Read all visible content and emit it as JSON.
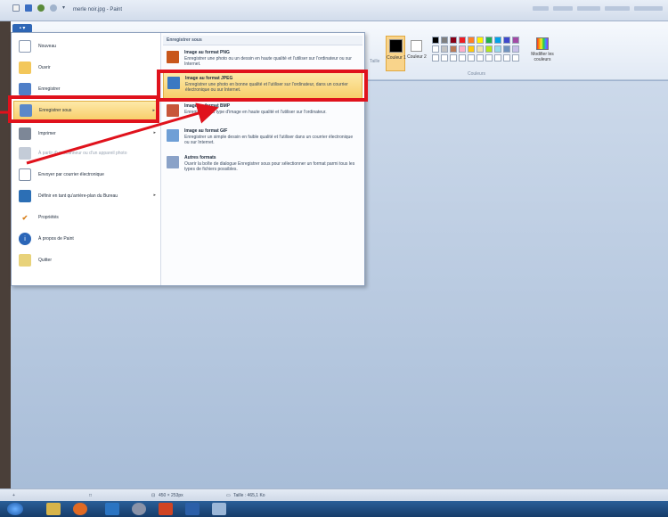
{
  "window": {
    "title": "merle noir.jpg - Paint",
    "file_tab": "▪ ▾"
  },
  "colors_panel": {
    "tail_label": "Taille",
    "color1_label": "Couleur 1",
    "color2_label": "Couleur 2",
    "edit_label": "Modifier les couleurs",
    "footer": "Couleurs",
    "swatches": [
      "#000000",
      "#7f7f7f",
      "#880015",
      "#ed1c24",
      "#ff7f27",
      "#fff200",
      "#22b14c",
      "#00a2e8",
      "#3f48cc",
      "#a349a4",
      "#ffffff",
      "#c3c3c3",
      "#b97a57",
      "#ffaec9",
      "#ffc90e",
      "#efe4b0",
      "#b5e61d",
      "#99d9ea",
      "#7092be",
      "#c8bfe7",
      "#ffffff",
      "#ffffff",
      "#ffffff",
      "#ffffff",
      "#ffffff",
      "#ffffff",
      "#ffffff",
      "#ffffff",
      "#ffffff",
      "#ffffff"
    ]
  },
  "file_menu": {
    "items": [
      {
        "label": "Nouveau",
        "icon": "new-document-icon"
      },
      {
        "label": "Ouvrir",
        "icon": "open-folder-icon"
      },
      {
        "label": "Enregistrer",
        "icon": "save-disk-icon"
      },
      {
        "label": "Enregistrer sous",
        "icon": "save-as-icon"
      },
      {
        "label": "Imprimer",
        "icon": "printer-icon"
      },
      {
        "label": "À partir d'un scanneur ou d'un appareil photo",
        "icon": "scanner-icon"
      },
      {
        "label": "Envoyer par courrier électronique",
        "icon": "email-icon"
      },
      {
        "label": "Définir en tant qu'arrière-plan du Bureau",
        "icon": "desktop-background-icon"
      },
      {
        "label": "Propriétés",
        "icon": "check-icon"
      },
      {
        "label": "À propos de Paint",
        "icon": "info-icon"
      },
      {
        "label": "Quitter",
        "icon": "exit-icon"
      }
    ],
    "submenu_title": "Enregistrer sous",
    "options": [
      {
        "title": "Image au format PNG",
        "desc": "Enregistrer une photo ou un dessin en haute qualité et l'utiliser sur l'ordinateur ou sur Internet."
      },
      {
        "title": "Image au format JPEG",
        "desc": "Enregistrer une photo en bonne qualité et l'utiliser sur l'ordinateur, dans un courrier électronique ou sur Internet."
      },
      {
        "title": "Image au format BMP",
        "desc": "Enregistrer tout type d'image en haute qualité et l'utiliser sur l'ordinateur."
      },
      {
        "title": "Image au format GIF",
        "desc": "Enregistrer un simple dessin en faible qualité et l'utiliser dans un courrier électronique ou sur Internet."
      },
      {
        "title": "Autres formats",
        "desc": "Ouvrir la boîte de dialogue Enregistrer sous pour sélectionner un format parmi tous les types de fichiers possibles."
      }
    ]
  },
  "status_bar": {
    "dimensions": "450 × 253px",
    "size": "Taille : 465,1 Ko"
  }
}
